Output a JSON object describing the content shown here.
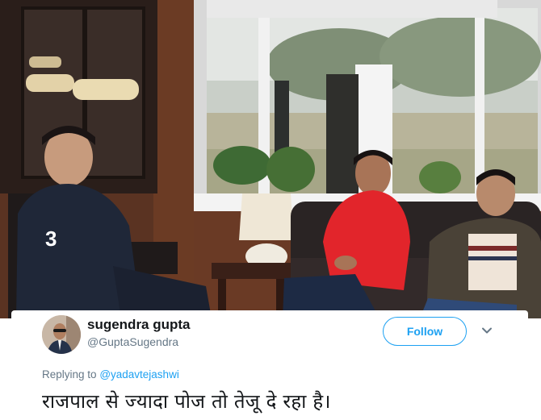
{
  "tweet": {
    "display_name": "sugendra gupta",
    "handle": "@GuptaSugendra",
    "follow_label": "Follow",
    "replying_to_prefix": "Replying to",
    "replying_to_handle": "@yadavtejashwi",
    "text": "राजपाल से ज्यादा पोज तो तेजू दे रहा है।"
  },
  "photo": {
    "jersey_number": "3"
  },
  "colors": {
    "accent": "#1da1f2",
    "primary_text": "#14171a",
    "secondary_text": "#657786"
  }
}
